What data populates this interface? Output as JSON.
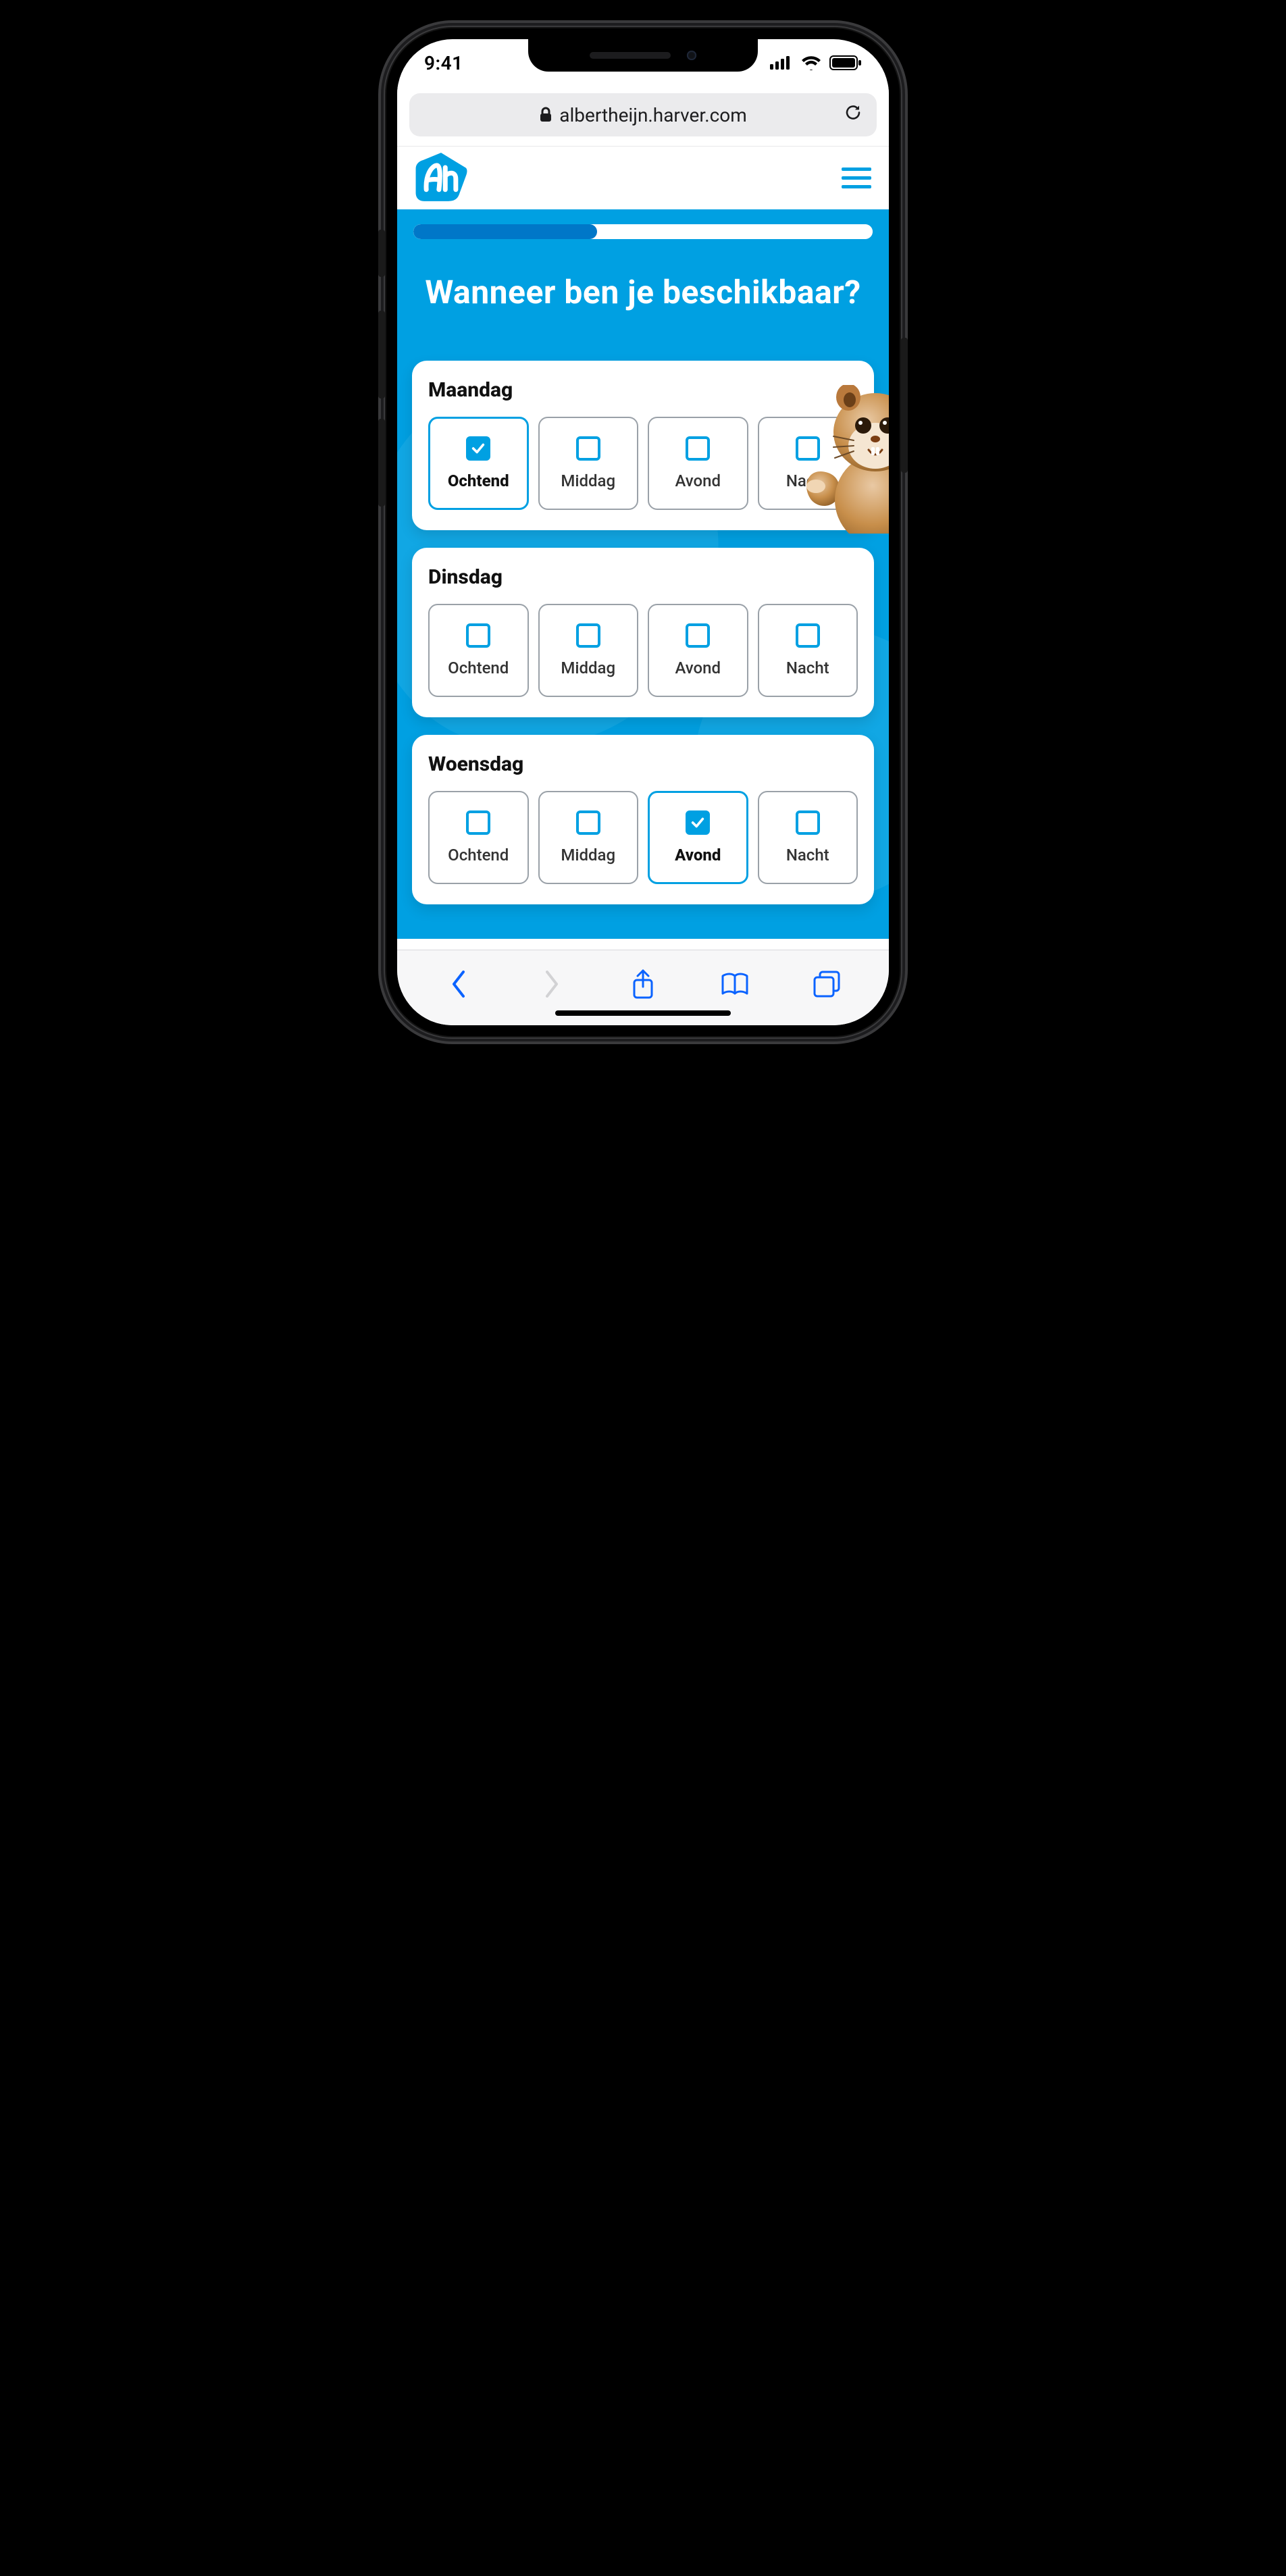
{
  "status": {
    "time": "9:41"
  },
  "safari": {
    "url_host": "albertheijn.harver.com"
  },
  "brand": {
    "accent": "#00a0e2",
    "primary": "#0077c8"
  },
  "progress": {
    "percent": 40
  },
  "question": {
    "heading": "Wanneer ben je beschikbaar?"
  },
  "days": [
    {
      "name": "Maandag",
      "slots": [
        {
          "label": "Ochtend",
          "selected": true
        },
        {
          "label": "Middag",
          "selected": false
        },
        {
          "label": "Avond",
          "selected": false
        },
        {
          "label": "Nacht",
          "selected": false
        }
      ]
    },
    {
      "name": "Dinsdag",
      "slots": [
        {
          "label": "Ochtend",
          "selected": false
        },
        {
          "label": "Middag",
          "selected": false
        },
        {
          "label": "Avond",
          "selected": false
        },
        {
          "label": "Nacht",
          "selected": false
        }
      ]
    },
    {
      "name": "Woensdag",
      "slots": [
        {
          "label": "Ochtend",
          "selected": false
        },
        {
          "label": "Middag",
          "selected": false
        },
        {
          "label": "Avond",
          "selected": true
        },
        {
          "label": "Nacht",
          "selected": false
        }
      ]
    }
  ]
}
